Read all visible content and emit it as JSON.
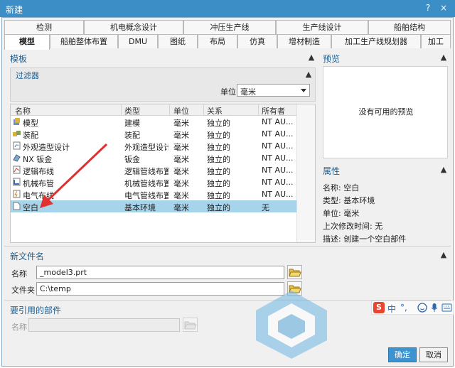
{
  "window": {
    "title": "新建",
    "help_glyph": "?",
    "close_glyph": "×"
  },
  "tabs_row1": [
    "检测",
    "机电概念设计",
    "冲压生产线",
    "生产线设计",
    "船舶结构"
  ],
  "tabs_row2": [
    "模型",
    "船舶整体布置",
    "DMU",
    "图纸",
    "布局",
    "仿真",
    "增材制造",
    "加工生产线规划器",
    "加工"
  ],
  "active_tab": "模型",
  "templates": {
    "header": "模板",
    "filter_label": "过滤器",
    "unit_label": "单位",
    "unit_value": "毫米",
    "columns": [
      "名称",
      "类型",
      "单位",
      "关系",
      "所有者"
    ],
    "rows": [
      {
        "name": "模型",
        "type": "建模",
        "unit": "毫米",
        "relation": "独立的",
        "owner": "NT AU...",
        "icon": "model-icon"
      },
      {
        "name": "装配",
        "type": "装配",
        "unit": "毫米",
        "relation": "独立的",
        "owner": "NT AU...",
        "icon": "assembly-icon"
      },
      {
        "name": "外观造型设计",
        "type": "外观造型设计",
        "unit": "毫米",
        "relation": "独立的",
        "owner": "NT AU...",
        "icon": "shape-studio-icon"
      },
      {
        "name": "NX 钣金",
        "type": "钣金",
        "unit": "毫米",
        "relation": "独立的",
        "owner": "NT AU...",
        "icon": "sheet-metal-icon"
      },
      {
        "name": "逻辑布线",
        "type": "逻辑管线布置",
        "unit": "毫米",
        "relation": "独立的",
        "owner": "NT AU...",
        "icon": "logical-routing-icon"
      },
      {
        "name": "机械布管",
        "type": "机械管线布置",
        "unit": "毫米",
        "relation": "独立的",
        "owner": "NT AU...",
        "icon": "mechanical-routing-icon"
      },
      {
        "name": "电气布线",
        "type": "电气管线布置",
        "unit": "毫米",
        "relation": "独立的",
        "owner": "NT AU...",
        "icon": "electrical-routing-icon"
      },
      {
        "name": "空白",
        "type": "基本环境",
        "unit": "毫米",
        "relation": "独立的",
        "owner": "无",
        "icon": "blank-icon"
      }
    ],
    "selected_row": "空白"
  },
  "preview": {
    "header": "预览",
    "empty_text": "没有可用的预览"
  },
  "properties": {
    "header": "属性",
    "items": [
      {
        "label": "名称:",
        "value": "空白"
      },
      {
        "label": "类型:",
        "value": "基本环境"
      },
      {
        "label": "单位:",
        "value": "毫米"
      },
      {
        "label": "上次修改时间:",
        "value": "无"
      },
      {
        "label": "描述:",
        "value": "创建一个空白部件"
      }
    ]
  },
  "new_file": {
    "header": "新文件名",
    "name_label": "名称",
    "name_value": "_model3.prt",
    "folder_label": "文件夹",
    "folder_value": "C:\\temp"
  },
  "reference": {
    "header": "要引用的部件",
    "name_label": "名称",
    "name_value": ""
  },
  "ime": {
    "label": "中",
    "punct": "°,"
  },
  "buttons": {
    "ok": "确定",
    "cancel": "取消"
  },
  "colors": {
    "titlebar": "#3b8fc6",
    "selection": "#a6d4ea",
    "header_text": "#1d5f93",
    "annotation_arrow": "#e03030"
  }
}
